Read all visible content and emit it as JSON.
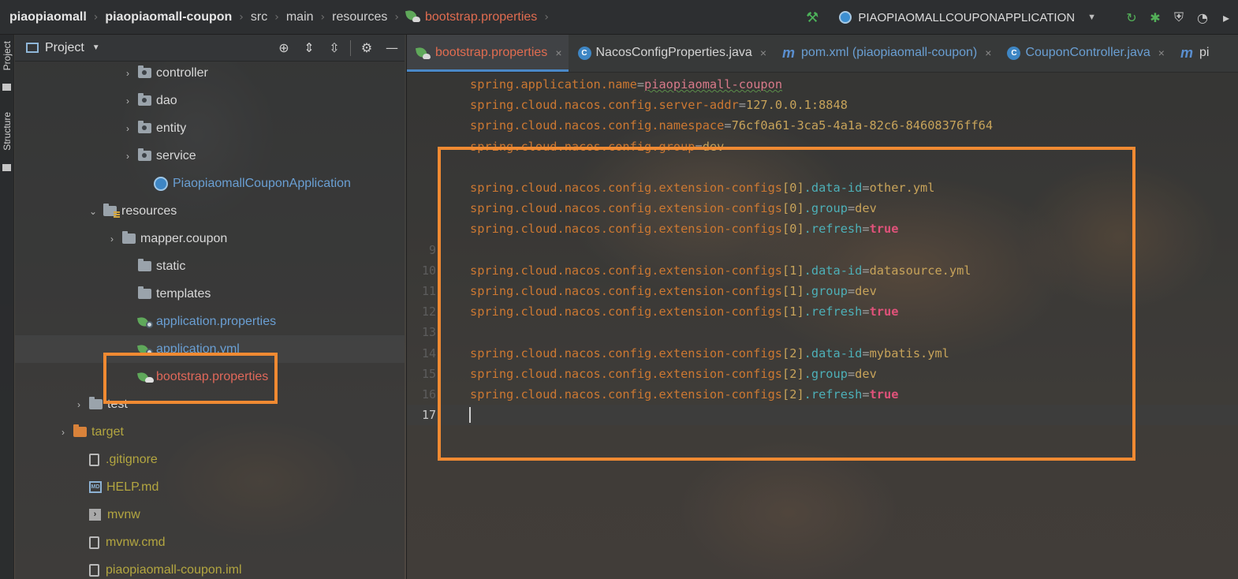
{
  "breadcrumb": {
    "items": [
      "piaopiaomall",
      "piaopiaomall-coupon",
      "src",
      "main",
      "resources",
      "bootstrap.properties"
    ],
    "separator": "›"
  },
  "run_config": {
    "name": "PIAOPIAOMALLCOUPONAPPLICATION"
  },
  "tool_windows": {
    "project_tab": "Project",
    "structure_tab": "Structure"
  },
  "project_panel": {
    "title": "Project",
    "tree": [
      {
        "label": "controller",
        "kind": "package",
        "expandable": true,
        "color": "white"
      },
      {
        "label": "dao",
        "kind": "package",
        "expandable": true,
        "color": "white"
      },
      {
        "label": "entity",
        "kind": "package",
        "expandable": true,
        "color": "white"
      },
      {
        "label": "service",
        "kind": "package",
        "expandable": true,
        "color": "white"
      },
      {
        "label": "PiaopiaomallCouponApplication",
        "kind": "spring-app",
        "expandable": false,
        "color": "blue"
      },
      {
        "label": "resources",
        "kind": "resources-folder",
        "expanded": true,
        "color": "white"
      },
      {
        "label": "mapper.coupon",
        "kind": "folder",
        "expandable": true,
        "color": "white"
      },
      {
        "label": "static",
        "kind": "folder",
        "expandable": false,
        "color": "white"
      },
      {
        "label": "templates",
        "kind": "folder",
        "expandable": false,
        "color": "white"
      },
      {
        "label": "application.properties",
        "kind": "spring-properties",
        "expandable": false,
        "color": "blue"
      },
      {
        "label": "application.yml",
        "kind": "spring-yml",
        "expandable": false,
        "color": "blue"
      },
      {
        "label": "bootstrap.properties",
        "kind": "spring-bootstrap",
        "expandable": false,
        "color": "red",
        "highlighted": true
      },
      {
        "label": "test",
        "kind": "folder",
        "expandable": true,
        "color": "white"
      },
      {
        "label": "target",
        "kind": "excluded-folder",
        "expandable": true,
        "color": "olive"
      },
      {
        "label": ".gitignore",
        "kind": "file",
        "expandable": false,
        "color": "olive"
      },
      {
        "label": "HELP.md",
        "kind": "markdown",
        "expandable": false,
        "color": "olive"
      },
      {
        "label": "mvnw",
        "kind": "script",
        "expandable": false,
        "color": "olive"
      },
      {
        "label": "mvnw.cmd",
        "kind": "file",
        "expandable": false,
        "color": "olive"
      },
      {
        "label": "piaopiaomall-coupon.iml",
        "kind": "file",
        "expandable": false,
        "color": "olive"
      }
    ]
  },
  "editor": {
    "tabs": [
      {
        "label": "bootstrap.properties",
        "active": true,
        "icon": "spring-bootstrap-icon"
      },
      {
        "label": "NacosConfigProperties.java",
        "active": false,
        "icon": "java-class-icon"
      },
      {
        "label": "pom.xml (piaopiaomall-coupon)",
        "active": false,
        "icon": "maven-icon"
      },
      {
        "label": "CouponController.java",
        "active": false,
        "icon": "java-class-icon"
      },
      {
        "label": "pi",
        "active": false,
        "icon": "maven-icon"
      }
    ],
    "lines": [
      {
        "no": "",
        "key": "spring.application.name",
        "value": "piaopiaomall-coupon",
        "vtype": "squiggle"
      },
      {
        "no": "",
        "key": "spring.cloud.nacos.config.server-addr",
        "value": "127.0.0.1:8848",
        "vtype": "str"
      },
      {
        "no": "",
        "key": "spring.cloud.nacos.config.namespace",
        "value": "76cf0a61-3ca5-4a1a-82c6-84608376ff64",
        "vtype": "str"
      },
      {
        "no": "",
        "key": "spring.cloud.nacos.config.group",
        "value": "dev",
        "vtype": "str"
      },
      {
        "no": "",
        "key": "",
        "value": "",
        "vtype": "empty"
      },
      {
        "no": "",
        "prefix": "spring.cloud.nacos.config.extension-configs",
        "index": "0",
        "suffix": ".data-id",
        "value": "other.yml",
        "vtype": "str"
      },
      {
        "no": "",
        "prefix": "spring.cloud.nacos.config.extension-configs",
        "index": "0",
        "suffix": ".group",
        "value": "dev",
        "vtype": "str"
      },
      {
        "no": "",
        "prefix": "spring.cloud.nacos.config.extension-configs",
        "index": "0",
        "suffix": ".refresh",
        "value": "true",
        "vtype": "bool"
      },
      {
        "no": "9",
        "key": "",
        "value": "",
        "vtype": "empty"
      },
      {
        "no": "10",
        "prefix": "spring.cloud.nacos.config.extension-configs",
        "index": "1",
        "suffix": ".data-id",
        "value": "datasource.yml",
        "vtype": "str"
      },
      {
        "no": "11",
        "prefix": "spring.cloud.nacos.config.extension-configs",
        "index": "1",
        "suffix": ".group",
        "value": "dev",
        "vtype": "str"
      },
      {
        "no": "12",
        "prefix": "spring.cloud.nacos.config.extension-configs",
        "index": "1",
        "suffix": ".refresh",
        "value": "true",
        "vtype": "bool"
      },
      {
        "no": "13",
        "key": "",
        "value": "",
        "vtype": "empty"
      },
      {
        "no": "14",
        "prefix": "spring.cloud.nacos.config.extension-configs",
        "index": "2",
        "suffix": ".data-id",
        "value": "mybatis.yml",
        "vtype": "str"
      },
      {
        "no": "15",
        "prefix": "spring.cloud.nacos.config.extension-configs",
        "index": "2",
        "suffix": ".group",
        "value": "dev",
        "vtype": "str"
      },
      {
        "no": "16",
        "prefix": "spring.cloud.nacos.config.extension-configs",
        "index": "2",
        "suffix": ".refresh",
        "value": "true",
        "vtype": "bool"
      },
      {
        "no": "17",
        "key": "",
        "value": "",
        "vtype": "empty",
        "current": true
      }
    ]
  },
  "colors": {
    "highlight_box": "#f08a32",
    "key": "#cc7832",
    "value": "#c7a35a",
    "bool": "#e0527a",
    "tab_active_text": "#e06c50"
  }
}
